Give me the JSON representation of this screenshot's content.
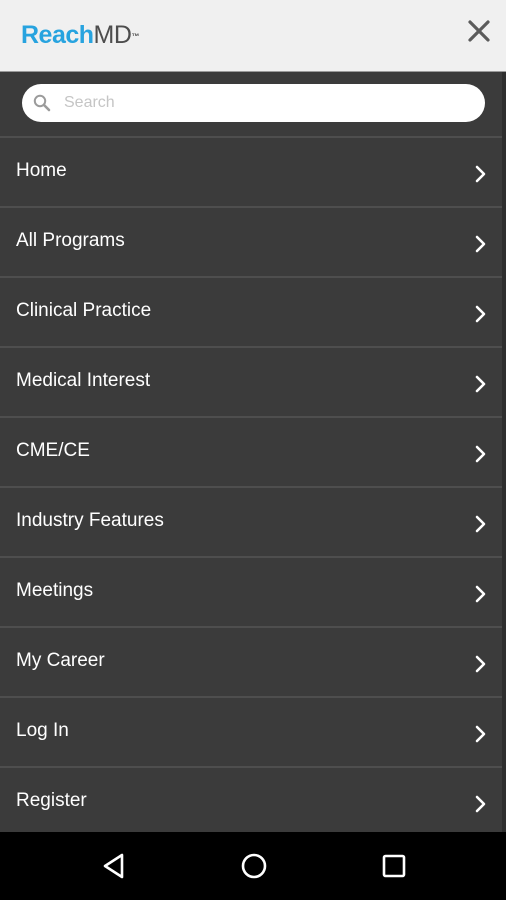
{
  "header": {
    "logo_part1": "Reach",
    "logo_part2": "MD",
    "logo_tm": "™"
  },
  "search": {
    "placeholder": "Search",
    "value": ""
  },
  "menu": {
    "items": [
      {
        "label": "Home"
      },
      {
        "label": "All Programs"
      },
      {
        "label": "Clinical Practice"
      },
      {
        "label": "Medical Interest"
      },
      {
        "label": "CME/CE"
      },
      {
        "label": "Industry Features"
      },
      {
        "label": "Meetings"
      },
      {
        "label": "My Career"
      },
      {
        "label": "Log In"
      },
      {
        "label": "Register"
      }
    ]
  },
  "icons": {
    "close": "close-icon",
    "search": "search-icon",
    "chevron": "chevron-right-icon",
    "nav_back": "back-triangle-icon",
    "nav_home": "home-circle-icon",
    "nav_recents": "recents-square-icon"
  },
  "colors": {
    "brand_blue": "#27a3df",
    "brand_gray": "#4d4d4d",
    "menu_bg": "#3b3b3b",
    "divider": "#4e4e4e",
    "header_bg": "#f0f0f0"
  }
}
